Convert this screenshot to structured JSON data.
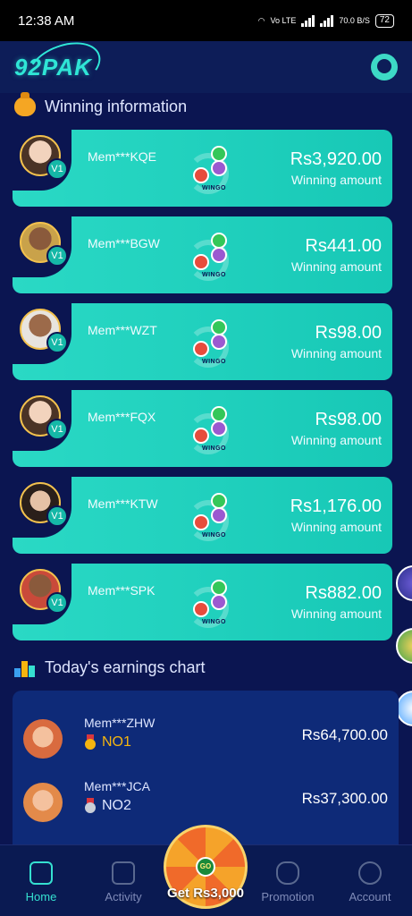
{
  "status": {
    "time": "12:38 AM",
    "network": "Vo LTE",
    "speed": "70.0 B/S",
    "battery": "72"
  },
  "header": {
    "logo": "92PAK",
    "service_icon": "customer-service-icon"
  },
  "winning": {
    "title": "Winning information",
    "amount_label": "Winning amount",
    "game": "WINGO",
    "items": [
      {
        "member": "Mem***KQE",
        "level": "V1",
        "amount": "Rs3,920.00"
      },
      {
        "member": "Mem***BGW",
        "level": "V1",
        "amount": "Rs441.00"
      },
      {
        "member": "Mem***WZT",
        "level": "V1",
        "amount": "Rs98.00"
      },
      {
        "member": "Mem***FQX",
        "level": "V1",
        "amount": "Rs98.00"
      },
      {
        "member": "Mem***KTW",
        "level": "V1",
        "amount": "Rs1,176.00"
      },
      {
        "member": "Mem***SPK",
        "level": "V1",
        "amount": "Rs882.00"
      }
    ]
  },
  "earnings": {
    "title": "Today's earnings chart",
    "items": [
      {
        "member": "Mem***ZHW",
        "rank": "NO1",
        "amount": "Rs64,700.00"
      },
      {
        "member": "Mem***JCA",
        "rank": "NO2",
        "amount": "Rs37,300.00"
      }
    ]
  },
  "nav": {
    "home": "Home",
    "activity": "Activity",
    "spin": "Get Rs3,000",
    "promotion": "Promotion",
    "account": "Account"
  },
  "colors": {
    "accent": "#2ad9c5",
    "background": "#0b1551",
    "active_nav": "#35e0d0"
  }
}
